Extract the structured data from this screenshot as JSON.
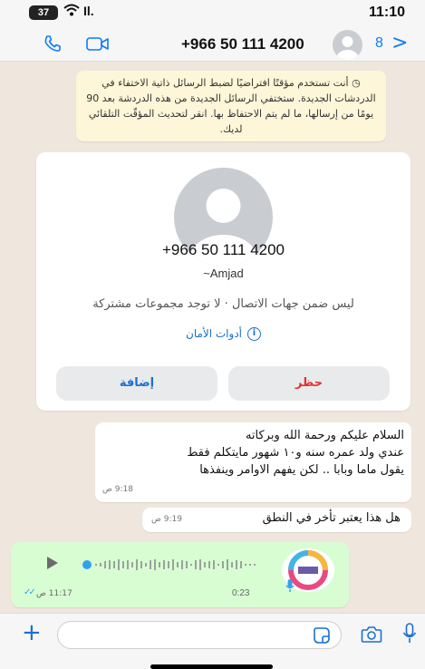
{
  "status_bar": {
    "time": "11:10",
    "battery": "37",
    "signal": "Il."
  },
  "header": {
    "title": "+966 50 111 4200",
    "unread_count": "8"
  },
  "notice": {
    "text": "أنت تستخدم مؤقتًا افتراضيًا لضبط الرسائل ذاتية الاختفاء في الدردشات الجديدة. ستختفي الرسائل الجديدة من هذه الدردشة بعد 90 يومًا من إرسالها، ما لم يتم الاحتفاظ بها. انقر لتحديث المؤقّت التلقائي لديك."
  },
  "contact_card": {
    "number": "+966 50 111 4200",
    "name": "~Amjad",
    "info": "ليس ضمن جهات الاتصال · لا توجد مجموعات مشتركة",
    "safety_tools": "أدوات الأمان",
    "block_label": "حظر",
    "add_label": "إضافة"
  },
  "messages": [
    {
      "text": "السلام عليكم ورحمة الله وبركاته\nعندي ولد عمره سنه و١٠ شهور مايتكلم فقط\nيقول ماما وبابا .. لكن يفهم الاوامر وينفذها",
      "time": "9:18 ص"
    },
    {
      "text": "هل هذا يعتبر تأخر في النطق",
      "time": "9:19 ص"
    }
  ],
  "voice_note": {
    "duration": "0:23",
    "time": "11:17 ص"
  },
  "icons": [
    "phone-icon",
    "video-icon",
    "chevron-right-icon",
    "timer-icon",
    "info-icon",
    "play-icon",
    "mic-icon",
    "plus-icon",
    "sticker-icon",
    "camera-icon"
  ],
  "colors": {
    "accent": "#0a7cff",
    "block": "#e0332f",
    "outgoing_bubble": "#d8fdd3",
    "chat_bg": "#efe7dd"
  }
}
